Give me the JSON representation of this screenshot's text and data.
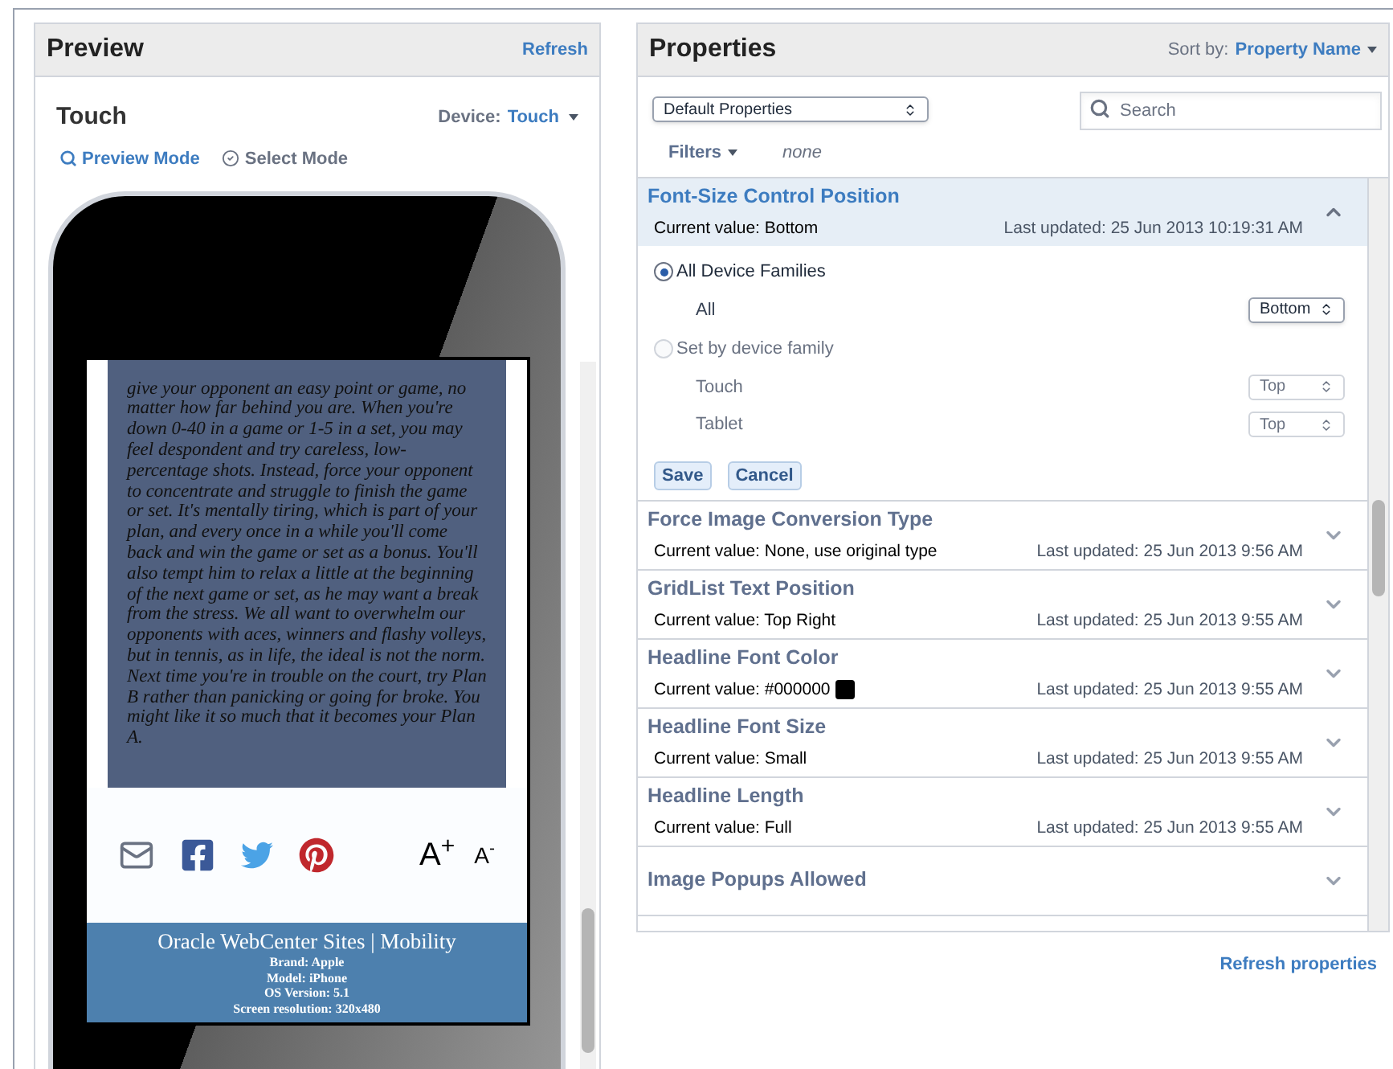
{
  "preview": {
    "title": "Preview",
    "refresh": "Refresh",
    "device_name": "Touch",
    "device_label": "Device:",
    "device_value": "Touch",
    "modes": [
      {
        "label": "Preview Mode",
        "selected": true
      },
      {
        "label": "Select Mode",
        "selected": false
      }
    ],
    "article": "give your opponent an easy point or game, no matter how far behind you are. When you're down 0-40 in a game or 1-5 in a set, you may feel despondent and try careless, low-percentage shots. Instead, force your opponent to concentrate and struggle to finish the game or set. It's mentally tiring, which is part of your plan, and every once in a while you'll come back and win the game or set as a bonus. You'll also tempt him to relax a little at the beginning of the next game or set, as he may want a break from the stress. We all want to overwhelm our opponents with aces, winners and flashy volleys, but in tennis, as in life, the ideal is not the norm. Next time you're in trouble on the court, try Plan B rather than panicking or going for broke. You might like it so much that it becomes your Plan A.",
    "share": [
      {
        "kind": "mail"
      },
      {
        "kind": "facebook"
      },
      {
        "kind": "twitter"
      },
      {
        "kind": "pinterest"
      }
    ],
    "font_controls": [
      "A$^{+}$",
      "A$^{-}$"
    ],
    "footer": {
      "title": "Oracle WebCenter Sites | Mobility",
      "lines": [
        "Brand: Apple",
        "Model: iPhone",
        "OS Version: 5.1",
        "Screen resolution: 320x480"
      ]
    }
  },
  "properties": {
    "title": "Properties",
    "sort_label": "Sort by:",
    "sort_value": "Property Name",
    "set_select": "Default Properties",
    "search_placeholder": "Search",
    "filters": "Filters",
    "filters_value": "none",
    "items": [
      {
        "name": "Font-Size Control Position",
        "expanded": true,
        "current_value": "Current value: Bottom",
        "last_updated": "Last updated: 25 Jun 2013 10:19:31 AM",
        "options": [
          {
            "label": "All Device Families",
            "selected": true,
            "rows": [
              {
                "label": "All",
                "value": "Bottom"
              }
            ]
          },
          {
            "label": "Set by device family",
            "selected": false,
            "rows": [
              {
                "label": "Touch",
                "value": "Top"
              },
              {
                "label": "Tablet",
                "value": "Top"
              }
            ]
          }
        ],
        "buttons": [
          "Save",
          "Cancel"
        ]
      },
      {
        "name": "Force Image Conversion Type",
        "expanded": false,
        "current_value": "Current value: None, use original type",
        "last_updated": "Last updated: 25 Jun 2013 9:56 AM"
      },
      {
        "name": "GridList Text Position",
        "expanded": false,
        "current_value": "Current value: Top Right",
        "last_updated": "Last updated: 25 Jun 2013 9:55 AM"
      },
      {
        "name": "Headline Font Color",
        "expanded": false,
        "current_value": "Current value: #000000",
        "color": "#000000",
        "last_updated": "Last updated: 25 Jun 2013 9:55 AM"
      },
      {
        "name": "Headline Font Size",
        "expanded": false,
        "current_value": "Current value: Small",
        "last_updated": "Last updated: 25 Jun 2013 9:55 AM"
      },
      {
        "name": "Headline Length",
        "expanded": false,
        "current_value": "Current value: Full",
        "last_updated": "Last updated: 25 Jun 2013 9:55 AM"
      },
      {
        "name": "Image Popups Allowed",
        "expanded": false
      }
    ],
    "refresh": "Refresh properties"
  }
}
